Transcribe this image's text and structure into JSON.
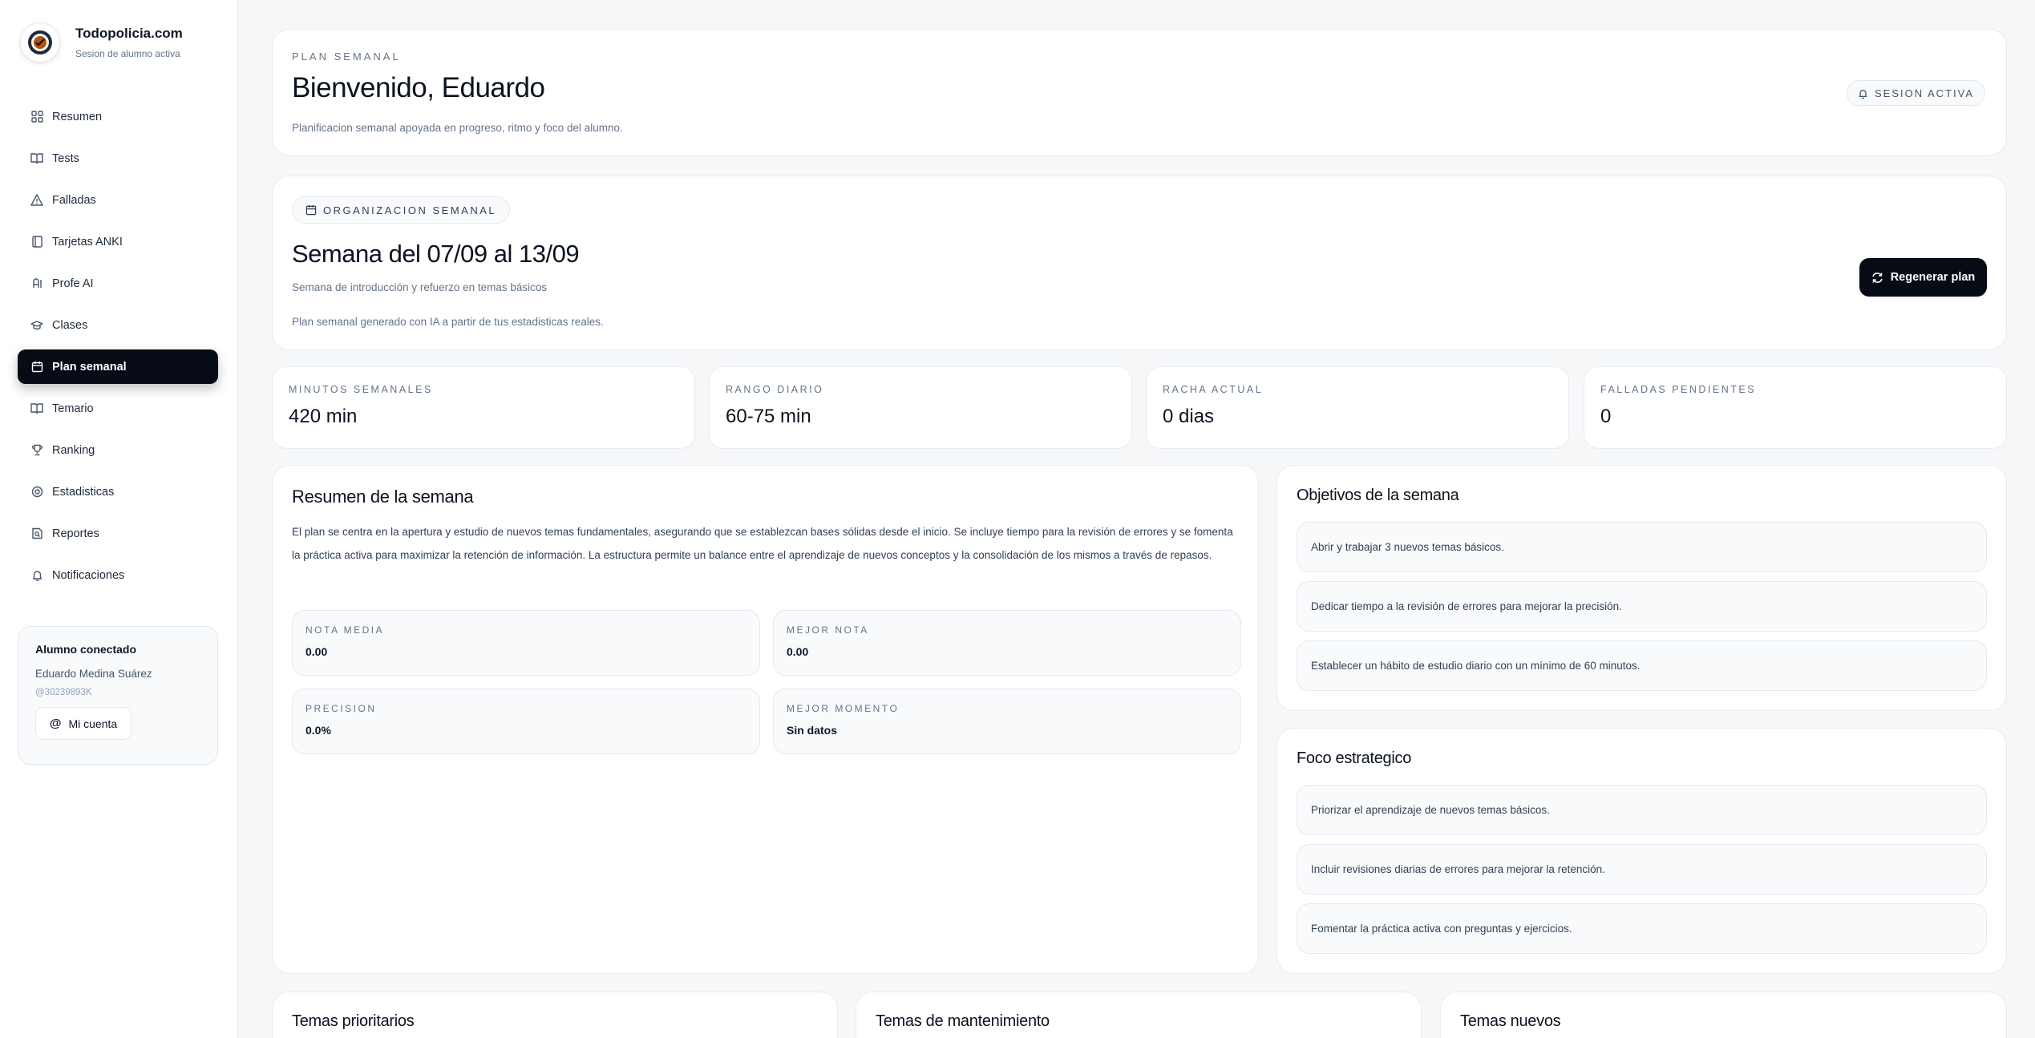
{
  "brand": {
    "title": "Todopolicia.com",
    "subtitle": "Sesion de alumno activa"
  },
  "nav": {
    "items": [
      {
        "label": "Resumen",
        "icon": "grid-icon"
      },
      {
        "label": "Tests",
        "icon": "book-icon"
      },
      {
        "label": "Falladas",
        "icon": "warning-icon"
      },
      {
        "label": "Tarjetas ANKI",
        "icon": "cards-icon"
      },
      {
        "label": "Profe AI",
        "icon": "ai-icon"
      },
      {
        "label": "Clases",
        "icon": "graduation-cap-icon"
      },
      {
        "label": "Plan semanal",
        "icon": "calendar-icon",
        "active": true
      },
      {
        "label": "Temario",
        "icon": "book-open-icon"
      },
      {
        "label": "Ranking",
        "icon": "trophy-icon"
      },
      {
        "label": "Estadisticas",
        "icon": "badge-icon"
      },
      {
        "label": "Reportes",
        "icon": "report-icon"
      },
      {
        "label": "Notificaciones",
        "icon": "bell-icon"
      }
    ]
  },
  "user": {
    "card_title": "Alumno conectado",
    "name": "Eduardo Medina Suárez",
    "handle": "@30239893K",
    "account_button": "Mi cuenta"
  },
  "header": {
    "eyebrow": "PLAN SEMANAL",
    "title": "Bienvenido, Eduardo",
    "subtitle": "Planificacion semanal apoyada en progreso, ritmo y foco del alumno.",
    "badge": "SESION ACTIVA"
  },
  "week": {
    "chip": "ORGANIZACION SEMANAL",
    "title": "Semana del 07/09 al 13/09",
    "subtitle": "Semana de introducción y refuerzo en temas básicos",
    "note": "Plan semanal generado con IA a partir de tus estadisticas reales.",
    "regen_button": "Regenerar plan"
  },
  "stats": [
    {
      "label": "MINUTOS SEMANALES",
      "value": "420 min"
    },
    {
      "label": "RANGO DIARIO",
      "value": "60-75 min"
    },
    {
      "label": "RACHA ACTUAL",
      "value": "0 dias"
    },
    {
      "label": "FALLADAS PENDIENTES",
      "value": "0"
    }
  ],
  "summary": {
    "title": "Resumen de la semana",
    "text": "El plan se centra en la apertura y estudio de nuevos temas fundamentales, asegurando que se establezcan bases sólidas desde el inicio. Se incluye tiempo para la revisión de errores y se fomenta la práctica activa para maximizar la retención de información. La estructura permite un balance entre el aprendizaje de nuevos conceptos y la consolidación de los mismos a través de repasos.",
    "metrics": [
      {
        "label": "NOTA MEDIA",
        "value": "0.00"
      },
      {
        "label": "MEJOR NOTA",
        "value": "0.00"
      },
      {
        "label": "PRECISION",
        "value": "0.0%"
      },
      {
        "label": "MEJOR MOMENTO",
        "value": "Sin datos"
      }
    ]
  },
  "objectives": {
    "title": "Objetivos de la semana",
    "items": [
      "Abrir y trabajar 3 nuevos temas básicos.",
      "Dedicar tiempo a la revisión de errores para mejorar la precisión.",
      "Establecer un hábito de estudio diario con un mínimo de 60 minutos."
    ]
  },
  "focus": {
    "title": "Foco estrategico",
    "items": [
      "Priorizar el aprendizaje de nuevos temas básicos.",
      "Incluir revisiones diarias de errores para mejorar la retención.",
      "Fomentar la práctica activa con preguntas y ejercicios."
    ]
  },
  "bottom": {
    "priority_title": "Temas prioritarios",
    "maintenance_title": "Temas de mantenimiento",
    "new_title": "Temas nuevos"
  }
}
